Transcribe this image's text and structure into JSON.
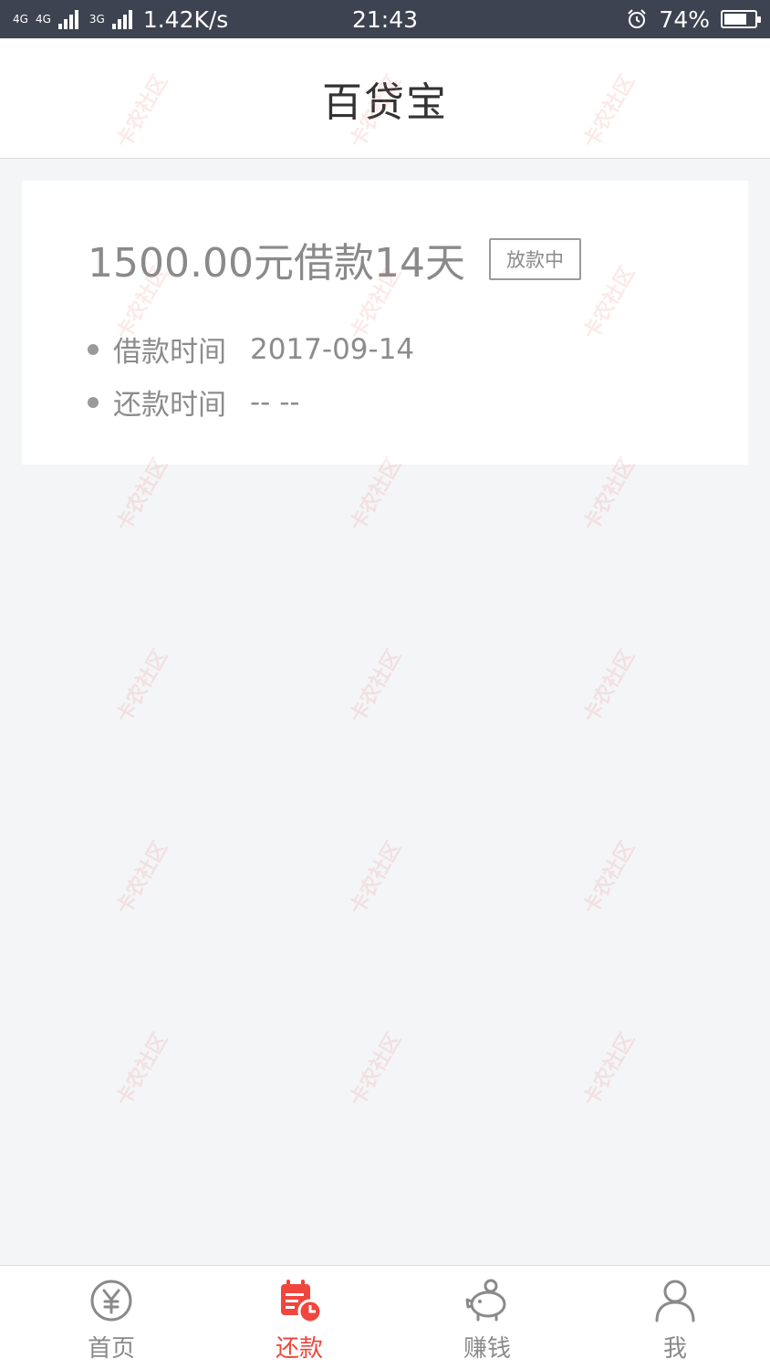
{
  "status_bar": {
    "network_1": "4G",
    "network_2": "4G",
    "network_3": "3G",
    "speed": "1.42K/s",
    "time": "21:43",
    "battery": "74%",
    "battery_level": 0.74
  },
  "header": {
    "title": "百贷宝"
  },
  "loan": {
    "title": "1500.00元借款14天",
    "status": "放款中",
    "rows": [
      {
        "label": "借款时间",
        "value": "2017-09-14"
      },
      {
        "label": "还款时间",
        "value": "-- --"
      }
    ]
  },
  "tabs": [
    {
      "label": "首页",
      "icon": "yuan-icon",
      "active": false
    },
    {
      "label": "还款",
      "icon": "calendar-clock-icon",
      "active": true
    },
    {
      "label": "赚钱",
      "icon": "piggy-bank-icon",
      "active": false
    },
    {
      "label": "我",
      "icon": "person-icon",
      "active": false
    }
  ],
  "watermark": "卡农社区",
  "colors": {
    "accent": "#f0463d",
    "status_bar": "#3d4350",
    "background": "#f4f5f7"
  }
}
